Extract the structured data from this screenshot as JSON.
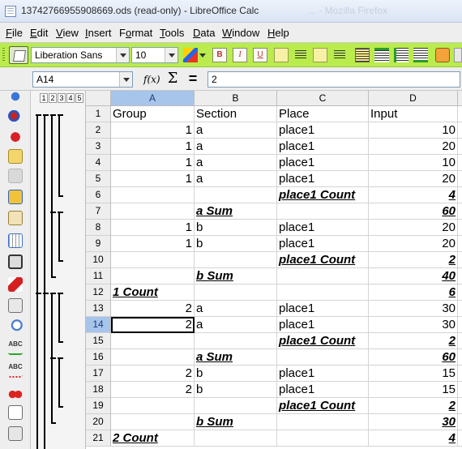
{
  "window": {
    "title": "13742766955908669.ods (read-only) - LibreOffice Calc",
    "ghost_title": "... - Mozilla Firefox"
  },
  "menu": [
    "File",
    "Edit",
    "View",
    "Insert",
    "Format",
    "Tools",
    "Data",
    "Window",
    "Help"
  ],
  "menu_underline": [
    "F",
    "E",
    "V",
    "I",
    "o",
    "T",
    "D",
    "W",
    "H"
  ],
  "toolbar": {
    "font_name": "Liberation Sans",
    "font_size": "10"
  },
  "formula_bar": {
    "name_box": "A14",
    "content": "2"
  },
  "outline_levels": [
    "1",
    "2",
    "3",
    "4",
    "5"
  ],
  "columns": [
    "A",
    "B",
    "C",
    "D"
  ],
  "selected_column": "A",
  "selected_row": 14,
  "active_cell": "A14",
  "rows": [
    {
      "n": "1",
      "a": "Group",
      "b": "Section",
      "c": "Place",
      "d": "Input",
      "type": "header"
    },
    {
      "n": "2",
      "a": "1",
      "b": "a",
      "c": "place1",
      "d": "10",
      "type": "data"
    },
    {
      "n": "3",
      "a": "1",
      "b": "a",
      "c": "place1",
      "d": "20",
      "type": "data"
    },
    {
      "n": "4",
      "a": "1",
      "b": "a",
      "c": "place1",
      "d": "10",
      "type": "data"
    },
    {
      "n": "5",
      "a": "1",
      "b": "a",
      "c": "place1",
      "d": "20",
      "type": "data"
    },
    {
      "n": "6",
      "a": "",
      "b": "",
      "c": "place1 Count",
      "d": "4",
      "type": "subtotal"
    },
    {
      "n": "7",
      "a": "",
      "b": "a Sum",
      "c": "",
      "d": "60",
      "type": "subtotal"
    },
    {
      "n": "8",
      "a": "1",
      "b": "b",
      "c": "place1",
      "d": "20",
      "type": "data"
    },
    {
      "n": "9",
      "a": "1",
      "b": "b",
      "c": "place1",
      "d": "20",
      "type": "data"
    },
    {
      "n": "10",
      "a": "",
      "b": "",
      "c": "place1 Count",
      "d": "2",
      "type": "subtotal"
    },
    {
      "n": "11",
      "a": "",
      "b": "b Sum",
      "c": "",
      "d": "40",
      "type": "subtotal"
    },
    {
      "n": "12",
      "a": "1 Count",
      "b": "",
      "c": "",
      "d": "6",
      "type": "subtotal"
    },
    {
      "n": "13",
      "a": "2",
      "b": "a",
      "c": "place1",
      "d": "30",
      "type": "data"
    },
    {
      "n": "14",
      "a": "2",
      "b": "a",
      "c": "place1",
      "d": "30",
      "type": "data"
    },
    {
      "n": "15",
      "a": "",
      "b": "",
      "c": "place1 Count",
      "d": "2",
      "type": "subtotal"
    },
    {
      "n": "16",
      "a": "",
      "b": "a Sum",
      "c": "",
      "d": "60",
      "type": "subtotal"
    },
    {
      "n": "17",
      "a": "2",
      "b": "b",
      "c": "place1",
      "d": "15",
      "type": "data"
    },
    {
      "n": "18",
      "a": "2",
      "b": "b",
      "c": "place1",
      "d": "15",
      "type": "data"
    },
    {
      "n": "19",
      "a": "",
      "b": "",
      "c": "place1 Count",
      "d": "2",
      "type": "subtotal"
    },
    {
      "n": "20",
      "a": "",
      "b": "b Sum",
      "c": "",
      "d": "30",
      "type": "subtotal"
    },
    {
      "n": "21",
      "a": "2 Count",
      "b": "",
      "c": "",
      "d": "4",
      "type": "subtotal"
    }
  ]
}
